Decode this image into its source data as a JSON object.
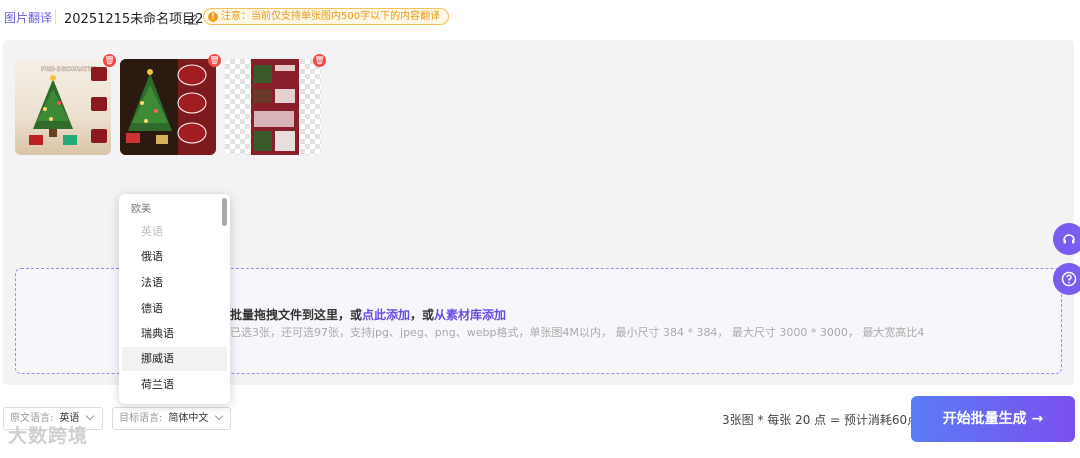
{
  "header": {
    "breadcrumb": "图片翻译",
    "project_title": "20251215未命名项目2",
    "notice": "注意：当前仅支持单张图内500字以下的内容翻译"
  },
  "images": [
    {
      "name": "thumb-1",
      "label": "PRE-DECORATED"
    },
    {
      "name": "thumb-2"
    },
    {
      "name": "thumb-3"
    }
  ],
  "dropzone": {
    "main_prefix": "批量拖拽文件到这里，或",
    "link_click": "点此添加",
    "middle": "，或",
    "link_library": "从素材库添加",
    "sub": "已选3张，还可选97张，支持jpg、jpeg、png、webp格式，单张图4M以内， 最小尺寸 384 * 384， 最大尺寸 3000 * 3000， 最大宽高比4"
  },
  "dropdown": {
    "group": "欧美",
    "options": [
      "英语",
      "俄语",
      "法语",
      "德语",
      "瑞典语",
      "挪威语",
      "荷兰语"
    ]
  },
  "footer": {
    "source_label": "原文语言:",
    "source_value": "英语",
    "target_label": "目标语言:",
    "target_value": "简体中文",
    "cost": "3张图 * 每张 20 点 = 预计消耗60点",
    "start_button": "开始批量生成 →",
    "watermark": "大数跨境"
  },
  "colors": {
    "accent": "#7b4ff0",
    "link": "#6b4de6",
    "notice": "#f39a1b",
    "delete": "#f04a4a"
  }
}
